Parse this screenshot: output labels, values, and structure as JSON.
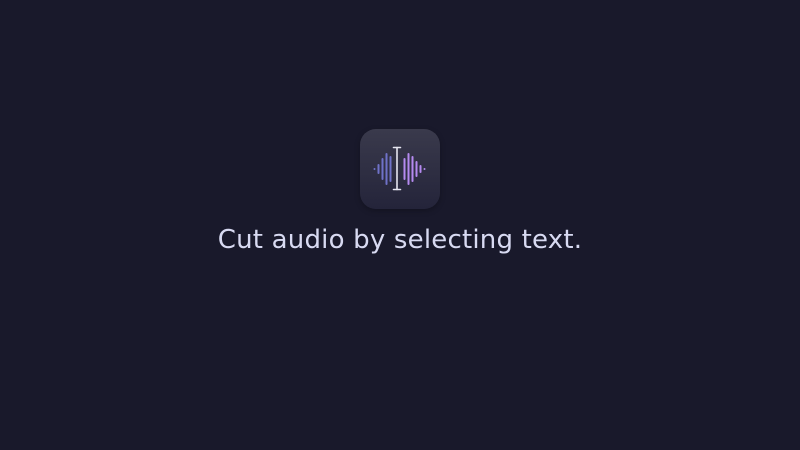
{
  "app": {
    "icon": "waveform-text-cursor-icon",
    "icon_colors": {
      "left_bars": "#6f72c8",
      "right_bars": "#b58af0",
      "cursor": "#e6e6f0"
    }
  },
  "tagline": "Cut audio by selecting text."
}
